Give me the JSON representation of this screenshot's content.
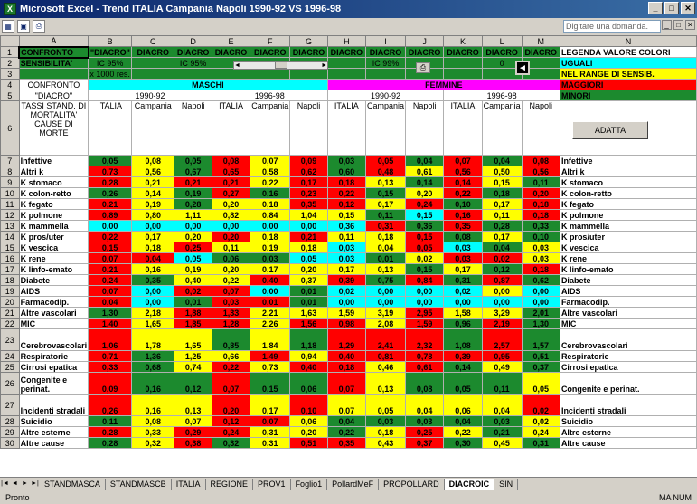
{
  "window": {
    "title": "Microsoft Excel - Trend ITALIA Campania Napoli 1990-92 VS 1996-98"
  },
  "toolbar": {
    "ask_placeholder": "Digitare una domanda."
  },
  "columns": [
    "A",
    "B",
    "C",
    "D",
    "E",
    "F",
    "G",
    "H",
    "I",
    "J",
    "K",
    "L",
    "M",
    "N"
  ],
  "top": {
    "r1": [
      "CONFRONTO",
      "\"DIACRO\"",
      "DIACRO",
      "DIACRO",
      "DIACRO",
      "DIACRO",
      "DIACRO",
      "DIACRO",
      "DIACRO",
      "DIACRO",
      "DIACRO",
      "DIACRO",
      "DIACRO",
      "LEGENDA VALORE COLORI"
    ],
    "r2_a": "SENSIBILITA'",
    "r2_b": "IC 95%",
    "r2_d": "IC 95%",
    "r2_i": "IC 99%",
    "r2_l": "0",
    "r2_n": "UGUALI",
    "r3_b": "x 1000 res.",
    "r3_n": "NEL RANGE DI SENSIB.",
    "r4_a": "CONFRONTO",
    "r4_maschi": "MASCHI",
    "r4_femmine": "FEMMINE",
    "r4_n": "MAGGIORI",
    "r5_a": "\"DIACRO\"",
    "r5_p1": "1990-92",
    "r5_p2": "1996-98",
    "r5_p3": "1990-92",
    "r5_p4": "1996-98",
    "r5_n": "MINORI",
    "r6_a": "TASSI STAND. DI MORTALITA' CAUSE DI MORTE",
    "r6_heads": [
      "ITALIA",
      "Campania",
      "Napoli",
      "ITALIA",
      "Campania",
      "Napoli",
      "ITALIA",
      "Campania",
      "Napoli",
      "ITALIA",
      "Campania",
      "Napoli"
    ],
    "adatta": "ADATTA"
  },
  "rows": [
    {
      "n": "7",
      "a": "Infettive",
      "v": [
        "0,05",
        "0,08",
        "0,05",
        "0,08",
        "0,07",
        "0,09",
        "0,03",
        "0,05",
        "0,04",
        "0,07",
        "0,04",
        "0,08"
      ],
      "c": "gygryrgrgrgr",
      "nl": "Infettive"
    },
    {
      "n": "8",
      "a": "Altri k",
      "v": [
        "0,73",
        "0,56",
        "0,67",
        "0,65",
        "0,58",
        "0,62",
        "0,60",
        "0,48",
        "0,61",
        "0,56",
        "0,50",
        "0,56"
      ],
      "c": "rygryrgryryr",
      "nl": "Altri k"
    },
    {
      "n": "9",
      "a": "K stomaco",
      "v": [
        "0,28",
        "0,21",
        "0,21",
        "0,21",
        "0,22",
        "0,17",
        "0,18",
        "0,13",
        "0,14",
        "0,14",
        "0,15",
        "0,11"
      ],
      "c": "ryrryrrygryg",
      "nl": "K stomaco"
    },
    {
      "n": "10",
      "a": "K colon-retto",
      "v": [
        "0,26",
        "0,14",
        "0,19",
        "0,27",
        "0,16",
        "0,23",
        "0,22",
        "0,15",
        "0,20",
        "0,22",
        "0,18",
        "0,20"
      ],
      "c": "gygrgrrgyrgr",
      "nl": "K colon-retto"
    },
    {
      "n": "11",
      "a": "K fegato",
      "v": [
        "0,21",
        "0,19",
        "0,28",
        "0,20",
        "0,18",
        "0,35",
        "0,12",
        "0,17",
        "0,24",
        "0,10",
        "0,17",
        "0,18"
      ],
      "c": "rygyyrryrgyr",
      "nl": "K fegato"
    },
    {
      "n": "12",
      "a": "K polmone",
      "v": [
        "0,89",
        "0,80",
        "1,11",
        "0,82",
        "0,84",
        "1,04",
        "0,15",
        "0,11",
        "0,15",
        "0,16",
        "0,11",
        "0,18"
      ],
      "c": "ryyyyyygcryr",
      "nl": "K polmone"
    },
    {
      "n": "13",
      "a": "K mammella",
      "v": [
        "0,00",
        "0,00",
        "0,00",
        "0,00",
        "0,00",
        "0,00",
        "0,36",
        "0,31",
        "0,36",
        "0,35",
        "0,28",
        "0,33"
      ],
      "c": "cccccccrgrgg",
      "nl": "K mammella"
    },
    {
      "n": "14",
      "a": "K pros/uter",
      "v": [
        "0,22",
        "0,17",
        "0,20",
        "0,20",
        "0,18",
        "0,21",
        "0,11",
        "0,18",
        "0,15",
        "0,08",
        "0,17",
        "0,10"
      ],
      "c": "ryyryryyrgyg",
      "nl": "K pros/uter"
    },
    {
      "n": "15",
      "a": "K vescica",
      "v": [
        "0,15",
        "0,18",
        "0,25",
        "0,11",
        "0,19",
        "0,18",
        "0,03",
        "0,04",
        "0,05",
        "0,03",
        "0,04",
        "0,03"
      ],
      "c": "ryryyycyrcgy",
      "nl": "K vescica"
    },
    {
      "n": "16",
      "a": "K rene",
      "v": [
        "0,07",
        "0,04",
        "0,05",
        "0,06",
        "0,03",
        "0,05",
        "0,03",
        "0,01",
        "0,02",
        "0,03",
        "0,02",
        "0,03"
      ],
      "c": "rrcggccgyrry",
      "nl": "K rene"
    },
    {
      "n": "17",
      "a": "K linfo-emato",
      "v": [
        "0,21",
        "0,16",
        "0,19",
        "0,20",
        "0,17",
        "0,20",
        "0,17",
        "0,13",
        "0,15",
        "0,17",
        "0,12",
        "0,18"
      ],
      "c": "ryyyyyyygygr",
      "nl": "K linfo-emato"
    },
    {
      "n": "18",
      "a": "Diabete",
      "v": [
        "0,24",
        "0,35",
        "0,40",
        "0,22",
        "0,40",
        "0,37",
        "0,39",
        "0,75",
        "0,84",
        "0,31",
        "0,87",
        "0,62"
      ],
      "c": "rgyyryrgrgrg",
      "nl": "Diabete"
    },
    {
      "n": "19",
      "a": "AIDS",
      "v": [
        "0,07",
        "0,00",
        "0,02",
        "0,07",
        "0,00",
        "0,01",
        "0,02",
        "0,00",
        "0,00",
        "0,02",
        "0,00",
        "0,00"
      ],
      "c": "rcrrcgccccyc",
      "nl": "AIDS"
    },
    {
      "n": "20",
      "a": "Farmacodip.",
      "v": [
        "0,04",
        "0,00",
        "0,01",
        "0,03",
        "0,01",
        "0,01",
        "0,00",
        "0,00",
        "0,00",
        "0,00",
        "0,00",
        "0,00"
      ],
      "c": "rcgrrgcccccc",
      "nl": "Farmacodip."
    },
    {
      "n": "21",
      "a": "Altre vascolari",
      "v": [
        "1,30",
        "2,18",
        "1,88",
        "1,33",
        "2,21",
        "1,63",
        "1,59",
        "3,19",
        "2,95",
        "1,58",
        "3,29",
        "2,01"
      ],
      "c": "gyrryyyyryyg",
      "nl": "Altre vascolari"
    },
    {
      "n": "22",
      "a": "MIC",
      "v": [
        "1,40",
        "1,65",
        "1,85",
        "1,28",
        "2,26",
        "1,56",
        "0,98",
        "2,08",
        "1,59",
        "0,96",
        "2,19",
        "1,30"
      ],
      "c": "ryrryrryrgrg",
      "nl": "MIC"
    },
    {
      "n": "23",
      "a": "Cerebrovascolari",
      "v": [
        "1,06",
        "1,78",
        "1,65",
        "0,85",
        "1,84",
        "1,18",
        "1,29",
        "2,41",
        "2,32",
        "1,08",
        "2,57",
        "1,57"
      ],
      "c": "ryygygrrrgrg",
      "nl": "Cerebrovascolari"
    },
    {
      "n": "24",
      "a": "Respiratorie",
      "v": [
        "0,71",
        "1,36",
        "1,25",
        "0,66",
        "1,49",
        "0,94",
        "0,40",
        "0,81",
        "0,78",
        "0,39",
        "0,95",
        "0,51"
      ],
      "c": "rgyyryrrrrrg",
      "nl": "Respiratorie"
    },
    {
      "n": "25",
      "a": "Cirrosi epatica",
      "v": [
        "0,33",
        "0,68",
        "0,74",
        "0,22",
        "0,73",
        "0,40",
        "0,18",
        "0,46",
        "0,61",
        "0,14",
        "0,49",
        "0,37"
      ],
      "c": "rgyryrryrgyg",
      "nl": "Cirrosi epatica"
    },
    {
      "n": "26",
      "a": "Congenite e perinat.",
      "v": [
        "0,09",
        "0,16",
        "0,12",
        "0,07",
        "0,15",
        "0,06",
        "0,07",
        "0,13",
        "0,08",
        "0,05",
        "0,11",
        "0,05"
      ],
      "c": "rggrggrygggy",
      "nl": "Congenite e perinat."
    },
    {
      "n": "27",
      "a": "Incidenti stradali",
      "v": [
        "0,26",
        "0,16",
        "0,13",
        "0,20",
        "0,17",
        "0,10",
        "0,07",
        "0,05",
        "0,04",
        "0,06",
        "0,04",
        "0,02"
      ],
      "c": "ryyryryyyyyr",
      "nl": "Incidenti stradali"
    },
    {
      "n": "28",
      "a": "Suicidio",
      "v": [
        "0,11",
        "0,08",
        "0,07",
        "0,12",
        "0,07",
        "0,06",
        "0,04",
        "0,03",
        "0,03",
        "0,04",
        "0,03",
        "0,02"
      ],
      "c": "gyyrrygggggy",
      "nl": "Suicidio"
    },
    {
      "n": "29",
      "a": "Altre esterne",
      "v": [
        "0,28",
        "0,33",
        "0,29",
        "0,24",
        "0,31",
        "0,20",
        "0,22",
        "0,18",
        "0,25",
        "0,22",
        "0,21",
        "0,24"
      ],
      "c": "ryrryygyrygy",
      "nl": "Altre esterne"
    },
    {
      "n": "30",
      "a": "Altre cause",
      "v": [
        "0,28",
        "0,32",
        "0,38",
        "0,32",
        "0,31",
        "0,51",
        "0,35",
        "0,43",
        "0,37",
        "0,30",
        "0,45",
        "0,31"
      ],
      "c": "gyrgyrryrgyg",
      "nl": "Altre cause"
    }
  ],
  "tabs": [
    "STANDMASCA",
    "STANDMASCB",
    "ITALIA",
    "REGIONE",
    "PROV1",
    "Foglio1",
    "PollardMeF",
    "PROPOLLARD",
    "DIACROIC",
    "SIN"
  ],
  "active_tab": "DIACROIC",
  "status": {
    "left": "Pronto",
    "right": "MA NUM"
  },
  "legend_colors": {
    "uguali": "#00ffff",
    "range": "#ffff00",
    "maggiori": "#ff0000",
    "minori": "#1c8a2e"
  }
}
